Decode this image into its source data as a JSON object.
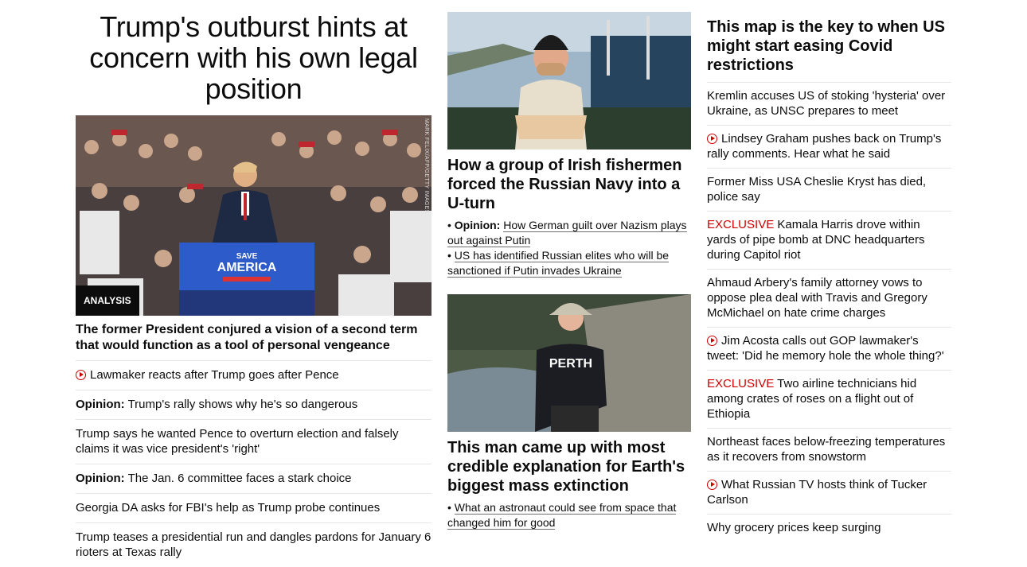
{
  "col1": {
    "headline": "Trump's outburst hints at concern with his own legal position",
    "image_credit": "MARK FELIX/AFP/GETTY IMAGES",
    "image_badge": "ANALYSIS",
    "sign_top": "SAVE",
    "sign_main": "AMERICA",
    "subhead": "The former President conjured a vision of a second term that would function as a tool of personal vengeance",
    "links": [
      {
        "prefix": "",
        "text": "Lawmaker reacts after Trump goes after Pence",
        "video": true
      },
      {
        "prefix": "Opinion:",
        "text": "Trump's rally shows why he's so dangerous",
        "video": false
      },
      {
        "prefix": "",
        "text": "Trump says he wanted Pence to overturn election and falsely claims it was vice president's 'right'",
        "video": false
      },
      {
        "prefix": "Opinion:",
        "text": "The Jan. 6 committee faces a stark choice",
        "video": false
      },
      {
        "prefix": "",
        "text": "Georgia DA asks for FBI's help as Trump probe continues",
        "video": false
      },
      {
        "prefix": "",
        "text": "Trump teases a presidential run and dangles pardons for January 6 rioters at Texas rally",
        "video": false
      }
    ]
  },
  "col2": {
    "card1": {
      "title": "How a group of Irish fishermen forced the Russian Navy into a U-turn",
      "links": [
        {
          "prefix": "Opinion:",
          "text": "How German guilt over Nazism plays out against Putin"
        },
        {
          "prefix": "",
          "text": "US has identified Russian elites who will be sanctioned if Putin invades Ukraine"
        }
      ]
    },
    "card2": {
      "title": "This man came up with most credible explanation for Earth's biggest mass extinction",
      "sweater_text": "PERTH",
      "links": [
        {
          "prefix": "",
          "text": "What an astronaut could see from space that changed him for good"
        }
      ]
    }
  },
  "col3": {
    "headline": "This map is the key to when US might start easing Covid restrictions",
    "links": [
      {
        "tag": "",
        "text": "Kremlin accuses US of stoking 'hysteria' over Ukraine, as UNSC prepares to meet",
        "video": false
      },
      {
        "tag": "",
        "text": "Lindsey Graham pushes back on Trump's rally comments. Hear what he said",
        "video": true
      },
      {
        "tag": "",
        "text": "Former Miss USA Cheslie Kryst has died, police say",
        "video": false
      },
      {
        "tag": "EXCLUSIVE",
        "text": "Kamala Harris drove within yards of pipe bomb at DNC headquarters during Capitol riot",
        "video": false
      },
      {
        "tag": "",
        "text": "Ahmaud Arbery's family attorney vows to oppose plea deal with Travis and Gregory McMichael on hate crime charges",
        "video": false
      },
      {
        "tag": "",
        "text": "Jim Acosta calls out GOP lawmaker's tweet: 'Did he memory hole the whole thing?'",
        "video": true
      },
      {
        "tag": "EXCLUSIVE",
        "text": "Two airline technicians hid among crates of roses on a flight out of Ethiopia",
        "video": false
      },
      {
        "tag": "",
        "text": "Northeast faces below-freezing temperatures as it recovers from snowstorm",
        "video": false
      },
      {
        "tag": "",
        "text": "What Russian TV hosts think of Tucker Carlson",
        "video": true
      },
      {
        "tag": "",
        "text": "Why grocery prices keep surging",
        "video": false
      }
    ]
  },
  "colors": {
    "accent_red": "#cc0000",
    "text": "#0c0c0c",
    "divider": "#e6e6e6"
  }
}
